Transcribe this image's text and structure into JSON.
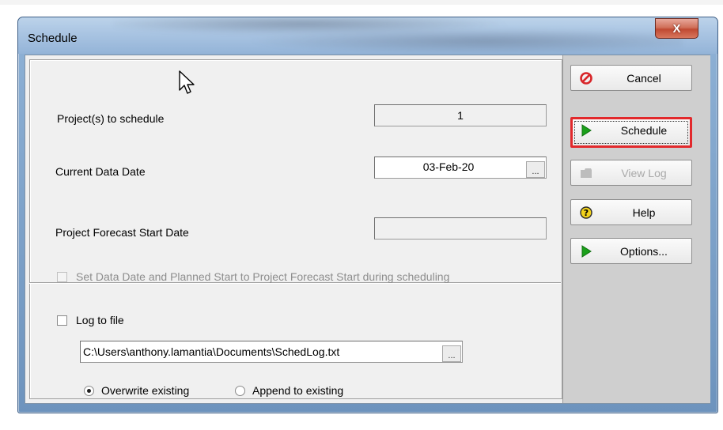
{
  "window": {
    "title": "Schedule",
    "close_glyph": "X"
  },
  "fields": {
    "projects_label": "Project(s) to schedule",
    "projects_value": "1",
    "data_date_label": "Current Data Date",
    "data_date_value": "03-Feb-20",
    "forecast_label": "Project Forecast Start Date",
    "forecast_value": "",
    "set_data_date_label": "Set Data Date and Planned Start to Project Forecast Start during scheduling",
    "log_to_file_label": "Log to file",
    "log_path": "C:\\Users\\anthony.lamantia\\Documents\\SchedLog.txt",
    "ellipsis": "...",
    "overwrite_label": "Overwrite existing",
    "append_label": "Append to existing"
  },
  "buttons": {
    "cancel": "Cancel",
    "schedule": "Schedule",
    "view_log": "View Log",
    "help": "Help",
    "options": "Options..."
  },
  "icons": {
    "cancel": "cancel-icon",
    "schedule": "play-icon",
    "view_log": "folder-icon",
    "help": "help-icon",
    "options": "play-icon"
  },
  "colors": {
    "highlight": "#e2292c",
    "cancel_red": "#d8262a",
    "play_green": "#1aa01a",
    "help_yellow": "#f2d21c"
  }
}
